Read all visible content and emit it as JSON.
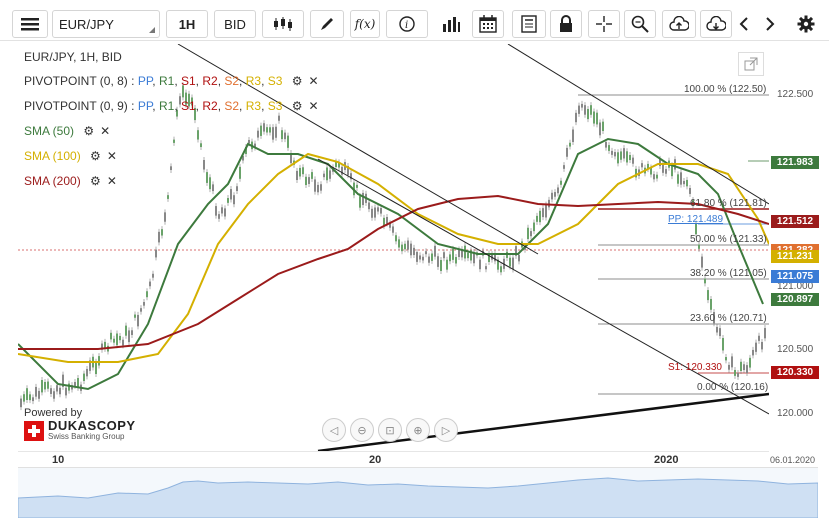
{
  "toolbar": {
    "symbol": "EUR/JPY",
    "timeframe": "1H",
    "price_side": "BID",
    "fx_label": "f(x)"
  },
  "chart": {
    "title": "EUR/JPY, 1H, BID",
    "legend": [
      {
        "name": "PIVOTPOINT (0, 8)",
        "labels": [
          "PP",
          "R1",
          "S1",
          "R2",
          "S2",
          "R3",
          "S3"
        ]
      },
      {
        "name": "PIVOTPOINT (0, 9)",
        "labels": [
          "PP",
          "R1",
          "S1",
          "R2",
          "S2",
          "R3",
          "S3"
        ]
      }
    ],
    "sma": [
      {
        "name": "SMA (50)",
        "color": "#3d7a3d"
      },
      {
        "name": "SMA (100)",
        "color": "#d4b000"
      },
      {
        "name": "SMA (200)",
        "color": "#9b1b1b"
      }
    ],
    "fib_levels": [
      "100.00 % (122.50)",
      "61.80 % (121.81)",
      "50.00 % (121.33)",
      "38.20 % (121.05)",
      "23.60 % (120.71)",
      "0.00 % (120.16)"
    ],
    "pivot_labels": {
      "pp": "PP: 121.489",
      "s1": "S1: 120.330"
    },
    "axis_labels": [
      "122.500",
      "121.000",
      "120.500",
      "120.000"
    ],
    "tags": [
      {
        "value": "121.983",
        "color": "#3d7a3d"
      },
      {
        "value": "121.512",
        "color": "#9b1b1b"
      },
      {
        "value": "121.282",
        "color": "#e07030"
      },
      {
        "value": "121.231",
        "color": "#d4b000"
      },
      {
        "value": "121.075",
        "color": "#3a7bd5"
      },
      {
        "value": "120.897",
        "color": "#3d7a3d"
      },
      {
        "value": "120.330",
        "color": "#b01010"
      }
    ],
    "x_labels": [
      "10",
      "20",
      "2020"
    ],
    "date_label": "06.01.2020",
    "powered_by": "Powered by",
    "brand": "DUKASCOPY",
    "brand_sub": "Swiss Banking Group"
  }
}
